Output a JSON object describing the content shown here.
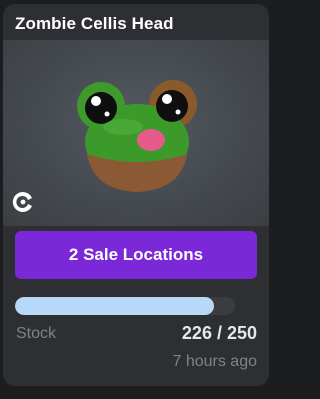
{
  "item": {
    "title": "Zombie Cellis Head",
    "image_icon": "frog-head-hat-icon",
    "creator_icon": "creator-logo-icon"
  },
  "actions": {
    "sale_locations_label": "2 Sale Locations"
  },
  "stock": {
    "label": "Stock",
    "count_text": "226 / 250",
    "current": 226,
    "total": 250,
    "fill_fraction": 0.904
  },
  "meta": {
    "timestamp": "7 hours ago"
  },
  "colors": {
    "card_bg": "#2d2f32",
    "button_bg": "#7a28d8",
    "progress_fill": "#b7d9f7"
  }
}
